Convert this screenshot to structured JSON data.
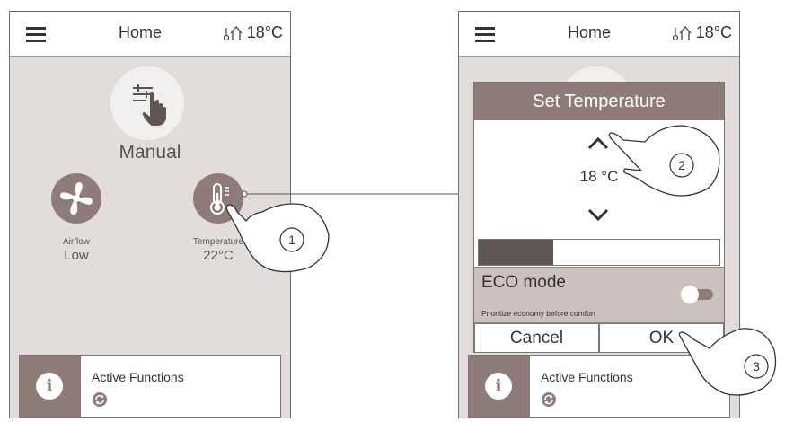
{
  "screen1": {
    "header": {
      "title": "Home",
      "indoor_temp": "18°C"
    },
    "mode": {
      "label": "Manual",
      "icon": "manual-hand-icon"
    },
    "airflow": {
      "label": "Airflow",
      "value": "Low"
    },
    "temperature": {
      "label": "Temperature",
      "value": "22°C"
    },
    "active_functions": {
      "label": "Active Functions"
    }
  },
  "screen2": {
    "header": {
      "title": "Home",
      "indoor_temp": "18°C"
    },
    "dialog": {
      "title": "Set Temperature",
      "value": "18 °C",
      "level_fraction": 0.31,
      "eco": {
        "title": "ECO mode",
        "subtitle": "Prioritize economy before comfort",
        "enabled": false
      },
      "cancel_label": "Cancel",
      "ok_label": "OK"
    },
    "active_functions": {
      "label": "Active Functions"
    }
  },
  "callouts": [
    "1",
    "2",
    "3"
  ],
  "colors": {
    "accent": "#8f7b78",
    "panel": "#e2dddb",
    "dark": "#5f5553"
  }
}
